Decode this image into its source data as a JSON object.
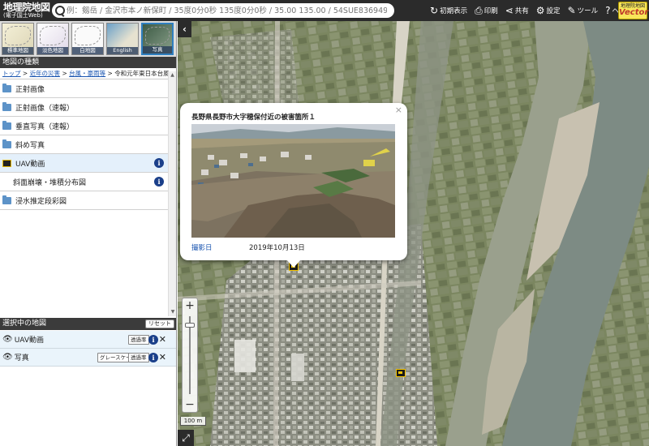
{
  "header": {
    "logo_line1": "地理院地図",
    "logo_line2": "(電子国土Web)",
    "search_placeholder": "例：剱岳 / 金沢市本ノ新保町 / 35度0分0秒 135度0分0秒 / 35.00 135.00 / 54SUE83694920",
    "buttons": [
      {
        "icon": "reset-view-icon",
        "glyph": "↻",
        "label": "初期表示"
      },
      {
        "icon": "print-icon",
        "glyph": "⎙",
        "label": "印刷"
      },
      {
        "icon": "share-icon",
        "glyph": "⋖",
        "label": "共有"
      },
      {
        "icon": "gear-icon",
        "glyph": "⚙",
        "label": "設定"
      },
      {
        "icon": "tool-icon",
        "glyph": "✎",
        "label": "ツール"
      },
      {
        "icon": "help-icon",
        "glyph": "?",
        "label": "ヘルプ"
      }
    ],
    "vector_badge_line1": "地理院地図",
    "vector_badge_line2": "Vector"
  },
  "panel": {
    "thumbnails": [
      "標準地図",
      "淡色地図",
      "白地図",
      "English",
      "写真"
    ],
    "title": "地図の種類",
    "breadcrumb": {
      "links": [
        "トップ",
        "近年の災害",
        "台風・豪雨等"
      ],
      "current": "令和元年東日本台風",
      "sep": " > "
    },
    "items": [
      {
        "label": "正射画像",
        "type": "folder"
      },
      {
        "label": "正射画像（速報）",
        "type": "folder"
      },
      {
        "label": "垂直写真（速報）",
        "type": "folder"
      },
      {
        "label": "斜め写真",
        "type": "folder"
      },
      {
        "label": "UAV動画",
        "type": "uav"
      },
      {
        "label": "斜面崩壊・堆積分布図",
        "type": "sub"
      },
      {
        "label": "浸水推定段彩図",
        "type": "folder"
      }
    ],
    "selected_title": "選択中の地図",
    "reset_label": "リセット",
    "selected": [
      {
        "label": "UAV動画",
        "tags": [
          "透過率"
        ]
      },
      {
        "label": "写真",
        "tags": [
          "グレースケール",
          "透過率"
        ]
      }
    ]
  },
  "map": {
    "scale_label": "100 m",
    "zoom_in": "+",
    "zoom_out": "−"
  },
  "popup": {
    "title": "長野県長野市大字穂保付近の被害箇所１",
    "date_label": "撮影日",
    "date_value": "2019年10月13日",
    "close": "×"
  },
  "colors": {
    "header_bg": "#2b2b2b",
    "link": "#1a55b0",
    "info_icon": "#1a3f8a",
    "marker_border": "#f2c200",
    "river": "#7d8b84"
  }
}
